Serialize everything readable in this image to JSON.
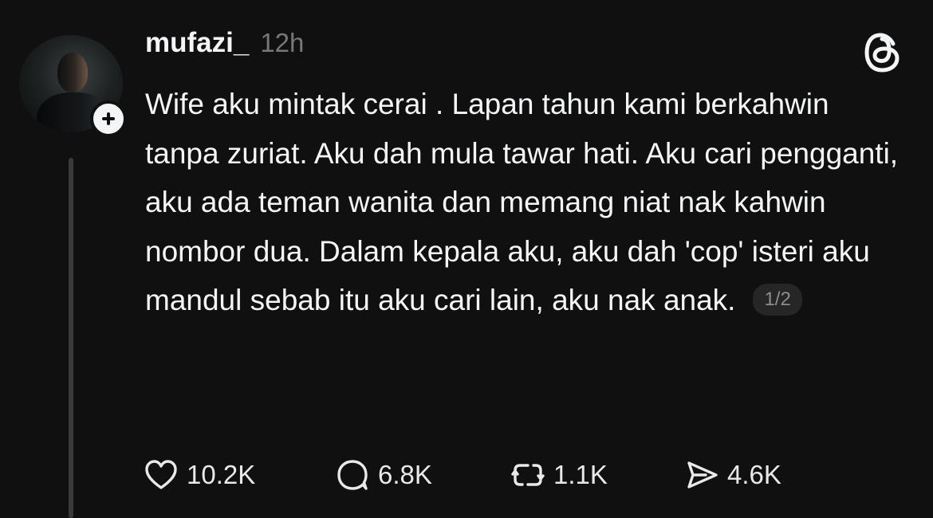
{
  "post": {
    "username": "mufazi_",
    "timestamp": "12h",
    "text": "Wife aku mintak cerai . Lapan tahun kami berkahwin tanpa zuriat. Aku dah mula tawar hati. Aku cari pengganti, aku ada teman wanita dan memang niat nak kahwin nombor dua. Dalam kepala aku, aku dah 'cop' isteri aku mandul sebab itu aku cari lain, aku nak anak.",
    "page_indicator": "1/2"
  },
  "actions": {
    "likes": "10.2K",
    "replies": "6.8K",
    "reposts": "1.1K",
    "shares": "4.6K"
  },
  "icons": {
    "like": "heart-icon",
    "reply": "comment-bubble-icon",
    "repost": "repost-icon",
    "share": "send-icon",
    "brand": "threads-logo-icon",
    "follow": "plus-icon"
  }
}
